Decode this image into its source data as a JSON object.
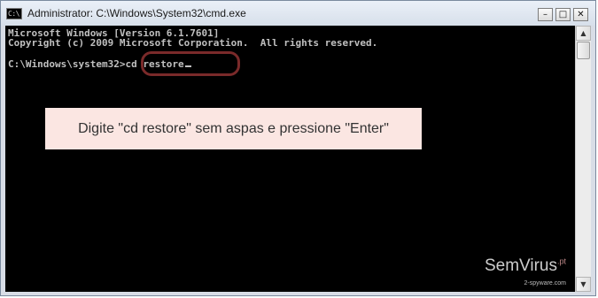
{
  "window": {
    "title": "Administrator: C:\\Windows\\System32\\cmd.exe",
    "icon_text": "C:\\",
    "icon": "console-icon",
    "minimize_glyph": "–",
    "maximize_glyph": "□",
    "close_glyph": "✕"
  },
  "console": {
    "lines": [
      "Microsoft Windows [Version 6.1.7601]",
      "Copyright (c) 2009 Microsoft Corporation.  All rights reserved.",
      ""
    ],
    "prompt": "C:\\Windows\\system32>",
    "command": "cd restore",
    "background": "#000000",
    "text_color": "#c0c0c0",
    "highlight_color": "#7a2a2a"
  },
  "callout": {
    "text": "Digite \"cd restore\" sem aspas e pressione \"Enter\"",
    "background": "#fbe6e2"
  },
  "watermark": {
    "text": "SemVirus",
    "suffix": ".pt",
    "subtext": "2-spyware.com"
  },
  "scrollbar": {
    "up_glyph": "▲",
    "down_glyph": "▼"
  }
}
